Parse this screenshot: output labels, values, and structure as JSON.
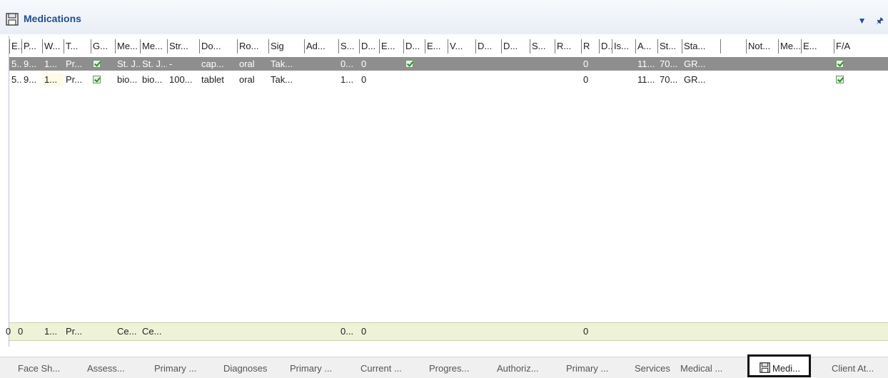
{
  "panel": {
    "title": "Medications",
    "dropdown_icon": "chevron-down-icon",
    "pin_icon": "pin-icon",
    "save_icon": "save-icon"
  },
  "columns": [
    "E...",
    "P...",
    "W...",
    "T...",
    "G...",
    "Me...",
    "Me...",
    "Str...",
    "Do...",
    "Ro...",
    "Sig",
    "Ad...",
    "S...",
    "D...",
    "E...",
    "D...",
    "E...",
    "V...",
    "D...",
    "D...",
    "S...",
    "R...",
    "R",
    "D..",
    "Is...",
    "A...",
    "St...",
    "Sta...",
    "",
    "Not...",
    "Me...",
    "E...",
    "F/A"
  ],
  "rows": [
    {
      "selected": true,
      "cells": [
        "5...",
        "9...",
        "1...",
        "Pr...",
        "✔",
        "St. J...",
        "St. J...",
        "-",
        "cap...",
        "oral",
        "Tak...",
        "",
        "0...",
        "0",
        "",
        "✔",
        "",
        "",
        "",
        "",
        "",
        "",
        "0",
        "",
        "",
        "11...",
        "70...",
        "GR...",
        "",
        "",
        "",
        "",
        "✔"
      ]
    },
    {
      "selected": false,
      "cells": [
        "5...",
        "9...",
        "1...",
        "Pr...",
        "✔",
        "bio...",
        "bio...",
        "100...",
        "tablet",
        "oral",
        "Tak...",
        "",
        "1...",
        "0",
        "",
        "",
        "",
        "",
        "",
        "",
        "",
        "",
        "0",
        "",
        "",
        "11...",
        "70...",
        "GR...",
        "",
        "",
        "",
        "",
        "✔"
      ]
    }
  ],
  "footer": [
    "0",
    "0",
    "1...",
    "Pr...",
    "",
    "Ce...",
    "Ce...",
    "",
    "",
    "",
    "",
    "",
    "0...",
    "0",
    "",
    "",
    "",
    "",
    "",
    "",
    "",
    "",
    "0",
    "",
    "",
    "",
    "",
    "",
    "",
    "",
    "",
    "",
    ""
  ],
  "tabs": [
    "Face Sh...",
    "Assess...",
    "Primary ...",
    "Diagnoses",
    "Primary ...",
    "Current ...",
    "Progres...",
    "Authoriz...",
    "Primary ...",
    "Services",
    "Medical ...",
    "Medi...",
    "Client At..."
  ],
  "active_tab_index": 11,
  "colors": {
    "title": "#1f4d8f",
    "selected_row": "#8e8e8e",
    "footer_row": "#eef3d8",
    "check_green": "#2e8b2e"
  }
}
